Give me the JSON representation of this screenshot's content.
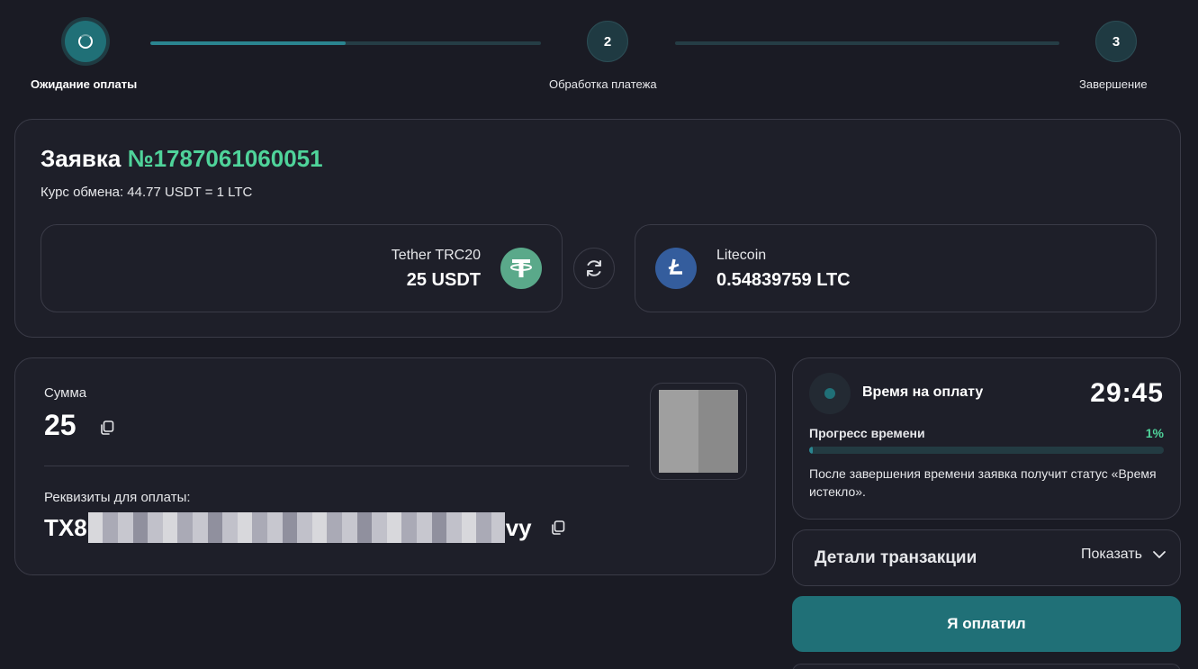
{
  "stepper": {
    "steps": [
      {
        "number": "",
        "label": "Ожидание оплаты",
        "state": "active"
      },
      {
        "number": "2",
        "label": "Обработка платежа",
        "state": "pending"
      },
      {
        "number": "3",
        "label": "Завершение",
        "state": "pending"
      }
    ],
    "progress": [
      0.5,
      0
    ]
  },
  "order": {
    "title_prefix": "Заявка",
    "number": "№1787061060051",
    "rate": "Курс обмена: 44.77 USDT = 1 LTC",
    "from": {
      "name": "Tether TRC20",
      "amount": "25 USDT",
      "icon": "tether-icon",
      "color": "#5aa98a"
    },
    "to": {
      "name": "Litecoin",
      "amount": "0.54839759 LTC",
      "icon": "litecoin-icon",
      "color": "#345d9d"
    }
  },
  "payment": {
    "sum_label": "Сумма",
    "sum_value": "25",
    "requisites_label": "Реквизиты для оплаты:",
    "address_start": "TX8",
    "address_end": "vy"
  },
  "timer": {
    "title": "Время на оплату",
    "value": "29:45",
    "progress_label": "Прогресс времени",
    "progress_pct": "1%",
    "progress_value": 0.01,
    "note": "После завершения времени заявка получит статус «Время истекло»."
  },
  "details": {
    "title": "Детали транзакции",
    "toggle_label": "Показать"
  },
  "actions": {
    "paid_label": "Я оплатил"
  },
  "colors": {
    "background": "#1a1b24",
    "card": "#1e1f29",
    "accent": "#207077",
    "highlight": "#4fd39a"
  }
}
